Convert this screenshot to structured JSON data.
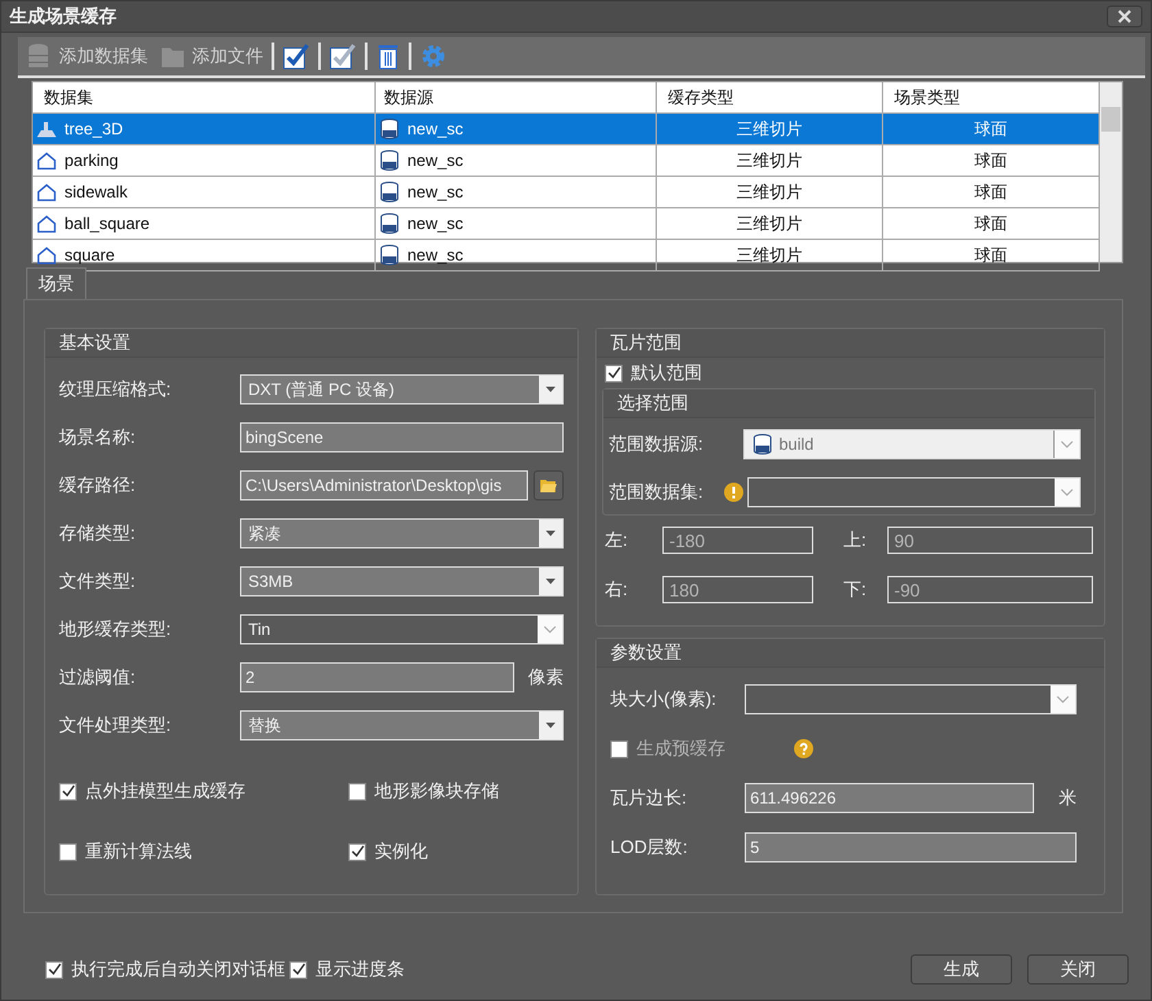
{
  "window": {
    "title": "生成场景缓存"
  },
  "toolbar": [
    {
      "kind": "database",
      "label": "添加数据集",
      "disabled": true
    },
    {
      "kind": "folder",
      "label": "添加文件",
      "disabled": true
    },
    {
      "kind": "check"
    },
    {
      "kind": "check-light"
    },
    {
      "kind": "trash"
    },
    {
      "kind": "gear"
    }
  ],
  "table": {
    "columns": [
      "数据集",
      "数据源",
      "缓存类型",
      "场景类型"
    ],
    "rows": [
      {
        "kind": "model",
        "dataset": "tree_3D",
        "source": "new_sc",
        "cache_type": "三维切片",
        "scene_type": "球面",
        "selected": true
      },
      {
        "kind": "region",
        "dataset": "parking",
        "source": "new_sc",
        "cache_type": "三维切片",
        "scene_type": "球面",
        "selected": false
      },
      {
        "kind": "region",
        "dataset": "sidewalk",
        "source": "new_sc",
        "cache_type": "三维切片",
        "scene_type": "球面",
        "selected": false
      },
      {
        "kind": "region",
        "dataset": "ball_square",
        "source": "new_sc",
        "cache_type": "三维切片",
        "scene_type": "球面",
        "selected": false
      },
      {
        "kind": "region",
        "dataset": "square",
        "source": "new_sc",
        "cache_type": "三维切片",
        "scene_type": "球面",
        "selected": false
      }
    ]
  },
  "tabs": [
    {
      "label": "场景"
    }
  ],
  "basic": {
    "title": "基本设置",
    "fields": [
      {
        "kind": "combo",
        "label": "纹理压缩格式:",
        "value": "DXT (普通 PC 设备)"
      },
      {
        "kind": "text",
        "label": "场景名称:",
        "value": "bingScene"
      },
      {
        "kind": "path",
        "label": "缓存路径:",
        "value": "C:\\Users\\Administrator\\Desktop\\gis"
      },
      {
        "kind": "combo",
        "label": "存储类型:",
        "value": "紧凑"
      },
      {
        "kind": "combo",
        "label": "文件类型:",
        "value": "S3MB"
      },
      {
        "kind": "dropdown",
        "label": "地形缓存类型:",
        "value": "Tin"
      },
      {
        "kind": "text",
        "label": "过滤阈值:",
        "value": "2",
        "unit": "像素"
      },
      {
        "kind": "combo",
        "label": "文件处理类型:",
        "value": "替换"
      }
    ],
    "checks": [
      {
        "label": "点外挂模型生成缓存",
        "checked": true
      },
      {
        "label": "地形影像块存储",
        "checked": false
      },
      {
        "label": "重新计算法线",
        "checked": false
      },
      {
        "label": "实例化",
        "checked": true
      }
    ]
  },
  "tile_range": {
    "title": "瓦片范围",
    "default_range": {
      "label": "默认范围",
      "checked": true
    },
    "select_range": {
      "title": "选择范围",
      "source": {
        "label": "范围数据源:",
        "value": "build"
      },
      "dataset": {
        "label": "范围数据集:"
      }
    },
    "bounds": [
      {
        "label": "左:",
        "value": "-180",
        "disabled": true
      },
      {
        "label": "上:",
        "value": "90",
        "disabled": true
      },
      {
        "label": "右:",
        "value": "180",
        "disabled": true
      },
      {
        "label": "下:",
        "value": "-90",
        "disabled": true
      }
    ]
  },
  "params": {
    "title": "参数设置",
    "block_size": {
      "label": "块大小(像素):"
    },
    "precache": {
      "label": "生成预缓存",
      "checked": false,
      "disabled": true
    },
    "tile_length": {
      "label": "瓦片边长:",
      "value": "611.496226",
      "unit": "米"
    },
    "lod": {
      "label": "LOD层数:",
      "value": "5"
    }
  },
  "footer": {
    "checks": [
      {
        "label": "执行完成后自动关闭对话框",
        "checked": true
      },
      {
        "label": "显示进度条",
        "checked": true
      }
    ],
    "buttons": [
      "生成",
      "关闭"
    ]
  }
}
